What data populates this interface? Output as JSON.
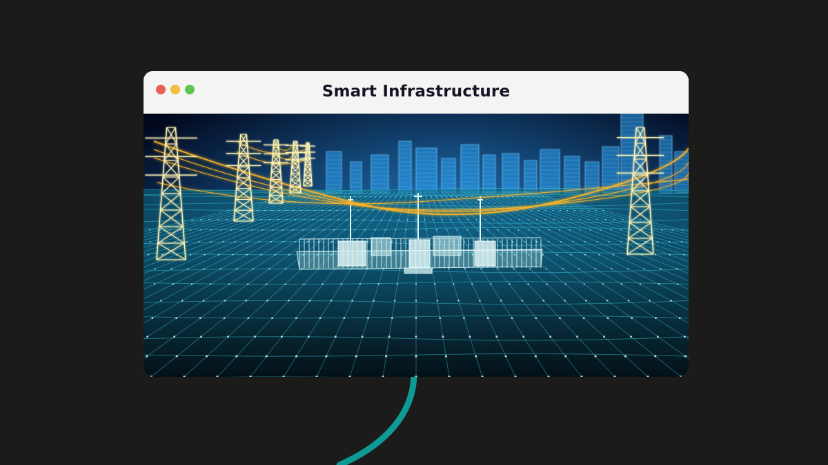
{
  "page": {
    "background": "#1b1b1a",
    "curve_color": "#0f9a96"
  },
  "window": {
    "title": "Smart Infrastructure",
    "controls": [
      {
        "name": "close",
        "color": "#e8615a"
      },
      {
        "name": "minimize",
        "color": "#f3bd3f"
      },
      {
        "name": "maximize",
        "color": "#5ec455"
      }
    ]
  },
  "scene": {
    "subject": "power-grid-digital-twin",
    "grid_color": "#3fd0e6",
    "sky_color": "#020a1e",
    "line_glow_color": "#ffb422",
    "tower_color": "#fff2b0",
    "city_color": "#2aa8ff"
  }
}
